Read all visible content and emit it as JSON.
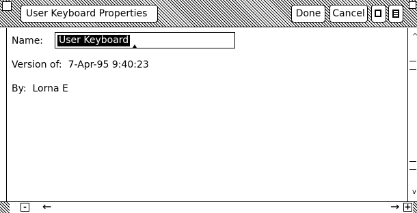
{
  "window": {
    "title": "User Keyboard Properties",
    "buttons": {
      "done": "Done",
      "cancel": "Cancel"
    },
    "icons": [
      "square-window-icon",
      "menu-icon"
    ]
  },
  "form": {
    "name_label": "Name:",
    "name_value": "User Keyboard",
    "version_label": "Version of:",
    "version_value": "7-Apr-95 9:40:23",
    "by_label": "By:",
    "by_value": "Lorna E"
  },
  "scrollbar": {
    "minus": "-",
    "plus": "+",
    "left_arrow": "←",
    "right_arrow": "→"
  }
}
